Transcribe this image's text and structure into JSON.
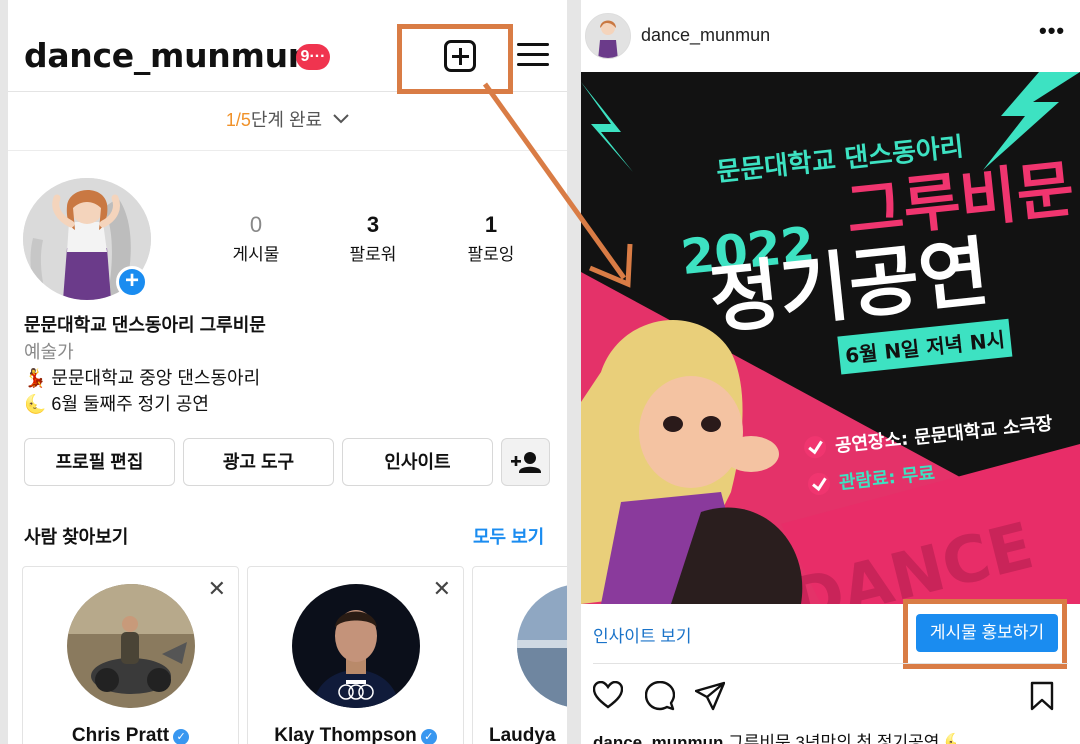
{
  "profile": {
    "username": "dance_munmun",
    "notification_badge": "9···",
    "progress_step": "1/5",
    "progress_text": "단계 완료",
    "stats": [
      {
        "value": "0",
        "label": "게시물"
      },
      {
        "value": "3",
        "label": "팔로워"
      },
      {
        "value": "1",
        "label": "팔로잉"
      }
    ],
    "bio_name": "문문대학교 댄스동아리 그루비문",
    "bio_category": "예술가",
    "bio_line1": "💃 문문대학교 중앙 댄스동아리",
    "bio_line2": "🌜 6월 둘째주 정기 공연",
    "buttons": {
      "edit_profile": "프로필 편집",
      "ad_tools": "광고 도구",
      "insights": "인사이트"
    },
    "discover_title": "사람 찾아보기",
    "see_all": "모두 보기",
    "suggestions": [
      {
        "name": "Chris Pratt"
      },
      {
        "name": "Klay Thompson"
      },
      {
        "name": "Laudya"
      }
    ]
  },
  "post": {
    "username": "dance_munmun",
    "poster": {
      "club_line": "문문대학교 댄스동아리",
      "year": "2022",
      "title1": "그루비문",
      "title2": "정기공연",
      "date": "6월 N일 저녁 N시",
      "place": "공연장소: 문문대학교 소극장",
      "fee": "관람료: 무료",
      "bg_word": "DANCE"
    },
    "insight_link": "인사이트 보기",
    "promote_button": "게시물 홍보하기",
    "caption_user": "dance_munmun",
    "caption_text": " 그루비문 3년만의 첫 정기공연 🌜"
  },
  "colors": {
    "accent_blue": "#1a8cf0",
    "annotation_orange": "#d97c45",
    "poster_pink": "#f0356f",
    "poster_teal": "#3de2c2",
    "badge_red": "#f0344f"
  }
}
